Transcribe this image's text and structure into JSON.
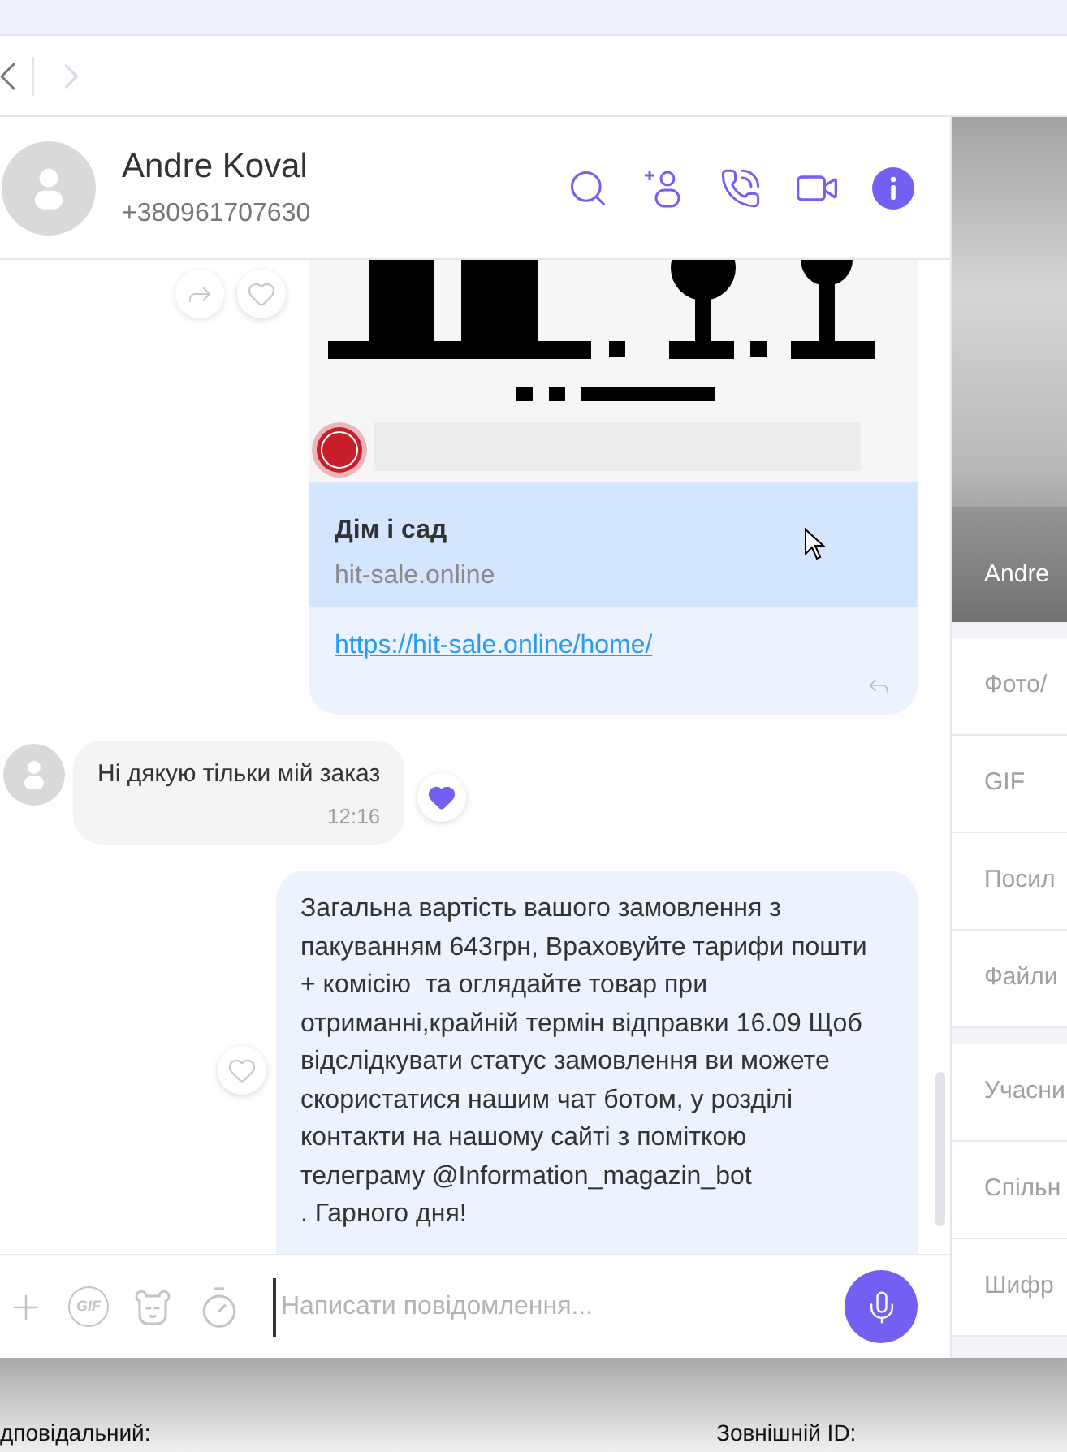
{
  "nav": {
    "back_disabled": false,
    "forward_disabled": true
  },
  "contact": {
    "name": "Andre Koval",
    "phone": "+380961707630"
  },
  "messages": [
    {
      "kind": "link_preview",
      "outgoing": true,
      "title": "Дім і сад",
      "domain": "hit-sale.online",
      "url": "https://hit-sale.online/home/",
      "liked": false
    },
    {
      "kind": "text",
      "outgoing": false,
      "text": "Ні дякую тільки мій заказ",
      "time": "12:16",
      "liked": true
    },
    {
      "kind": "text",
      "outgoing": true,
      "text": "Загальна вартість вашого замовлення з пакуванням 643грн, Враховуйте тарифи пошти + комісію  та оглядайте товар при отриманні,крайній термін відправки 16.09 Щоб відслідкувати статус замовлення ви можете скористатися нашим чат ботом, у розділі контакти на нашому сайті з поміткою телеграму @Information_magazin_bot\n. Гарного дня!",
      "liked": false
    }
  ],
  "composer": {
    "gif_label": "GIF",
    "placeholder": "Написати повідомлення..."
  },
  "side_panel": {
    "contact_name": "Andre",
    "sections": [
      [
        "Фото/",
        "GIF",
        "Посил",
        "Файли"
      ],
      [
        "Учасни",
        "Спільн",
        "Шифр"
      ]
    ]
  },
  "footer": {
    "fields": [
      "дповідальний:",
      "Зовнішній ID:"
    ]
  }
}
